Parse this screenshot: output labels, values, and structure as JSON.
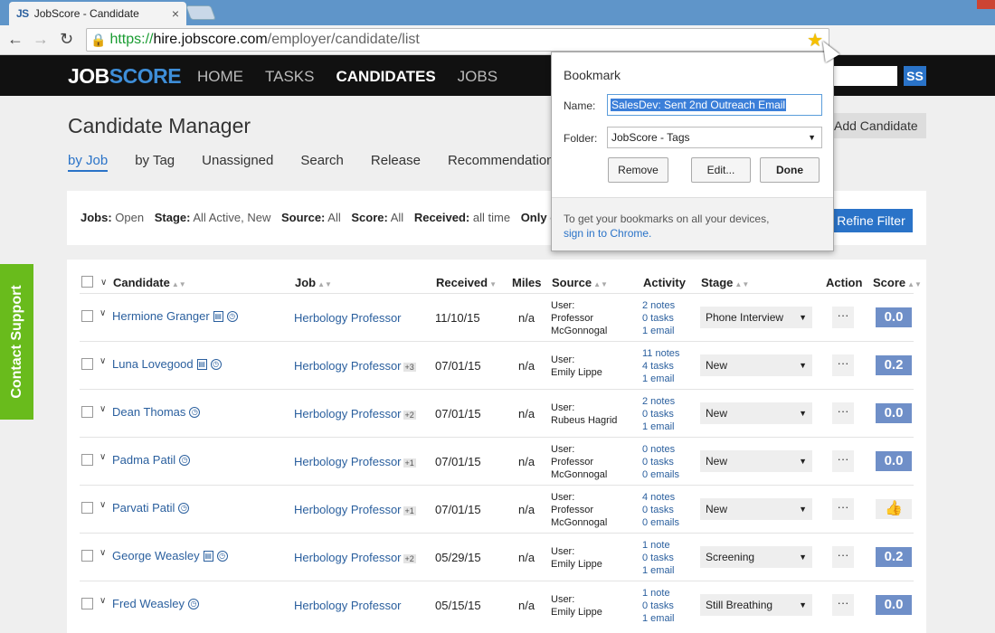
{
  "browser": {
    "tab_title": "JobScore - Candidate",
    "tab_favicon": "JS",
    "address": {
      "scheme": "https://",
      "host": "hire.jobscore.com",
      "path": "/employer/candidate/list"
    }
  },
  "header": {
    "logo_job": "JOB",
    "logo_score": "SCORE",
    "nav": [
      "HOME",
      "TASKS",
      "CANDIDATES",
      "JOBS"
    ],
    "active_nav": "CANDIDATES",
    "avatar": "SS"
  },
  "page": {
    "title": "Candidate Manager",
    "add_button": "Add Candidate",
    "subtabs": [
      "by Job",
      "by Tag",
      "Unassigned",
      "Search",
      "Release",
      "Recommendations"
    ]
  },
  "filters": {
    "jobs_label": "Jobs:",
    "jobs": "Open",
    "stage_label": "Stage:",
    "stage": "All Active, New",
    "source_label": "Source:",
    "source": "All",
    "score_label": "Score:",
    "score": "All",
    "received_label": "Received:",
    "received": "all time",
    "overdue": "Only overdu",
    "refine_button": "Refine Filter"
  },
  "table": {
    "headers": {
      "candidate": "Candidate",
      "job": "Job",
      "received": "Received",
      "miles": "Miles",
      "source": "Source",
      "activity": "Activity",
      "stage": "Stage",
      "action": "Action",
      "score": "Score"
    },
    "rows": [
      {
        "name": "Hermione Granger",
        "card": true,
        "job": "Herbology Professor",
        "extra": "",
        "received": "11/10/15",
        "miles": "n/a",
        "source": [
          "User:",
          "Professor",
          "McGonnogal"
        ],
        "activity": [
          "2 notes",
          "0 tasks",
          "1 email"
        ],
        "stage": "Phone Interview",
        "action": "···",
        "score": "0.0"
      },
      {
        "name": "Luna Lovegood",
        "card": true,
        "job": "Herbology Professor",
        "extra": "+3",
        "received": "07/01/15",
        "miles": "n/a",
        "source": [
          "User:",
          "Emily Lippe"
        ],
        "activity": [
          "11 notes",
          "4 tasks",
          "1 email"
        ],
        "stage": "New",
        "action": "···",
        "score": "0.2"
      },
      {
        "name": "Dean Thomas",
        "card": false,
        "job": "Herbology Professor",
        "extra": "+2",
        "received": "07/01/15",
        "miles": "n/a",
        "source": [
          "User:",
          "Rubeus Hagrid"
        ],
        "activity": [
          "2 notes",
          "0 tasks",
          "1 email"
        ],
        "stage": "New",
        "action": "···",
        "score": "0.0"
      },
      {
        "name": "Padma Patil",
        "card": false,
        "job": "Herbology Professor",
        "extra": "+1",
        "received": "07/01/15",
        "miles": "n/a",
        "source": [
          "User:",
          "Professor",
          "McGonnogal"
        ],
        "activity": [
          "0 notes",
          "0 tasks",
          "0 emails"
        ],
        "stage": "New",
        "action": "···",
        "score": "0.0"
      },
      {
        "name": "Parvati Patil",
        "card": false,
        "job": "Herbology Professor",
        "extra": "+1",
        "received": "07/01/15",
        "miles": "n/a",
        "source": [
          "User:",
          "Professor",
          "McGonnogal"
        ],
        "activity": [
          "4 notes",
          "0 tasks",
          "0 emails"
        ],
        "stage": "New",
        "action": "···",
        "score": "thumbs-up-icon"
      },
      {
        "name": "George Weasley",
        "card": true,
        "job": "Herbology Professor",
        "extra": "+2",
        "received": "05/29/15",
        "miles": "n/a",
        "source": [
          "User:",
          "Emily Lippe"
        ],
        "activity": [
          "1 note",
          "0 tasks",
          "1 email"
        ],
        "stage": "Screening",
        "action": "···",
        "score": "0.2"
      },
      {
        "name": "Fred Weasley",
        "card": false,
        "job": "Herbology Professor",
        "extra": "",
        "received": "05/15/15",
        "miles": "n/a",
        "source": [
          "User:",
          "Emily Lippe"
        ],
        "activity": [
          "1 note",
          "0 tasks",
          "1 email"
        ],
        "stage": "Still Breathing",
        "action": "···",
        "score": "0.0"
      }
    ]
  },
  "support_tab": "Contact Support",
  "bookmark": {
    "title": "Bookmark",
    "name_label": "Name:",
    "name_value": "SalesDev: Sent 2nd Outreach Email",
    "folder_label": "Folder:",
    "folder_value": "JobScore - Tags",
    "remove": "Remove",
    "edit": "Edit...",
    "done": "Done",
    "footer_text": "To get your bookmarks on all your devices,",
    "footer_link": "sign in to Chrome."
  }
}
